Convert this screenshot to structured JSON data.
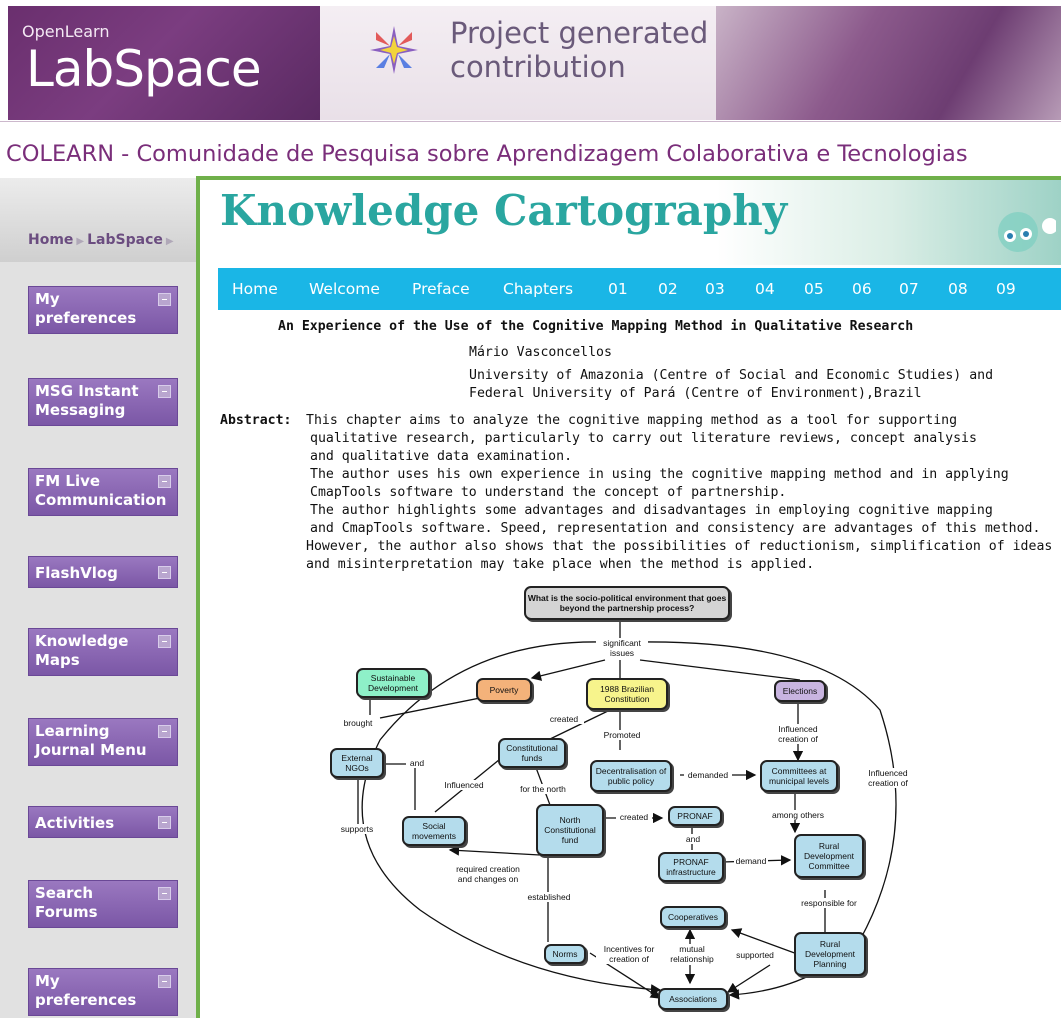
{
  "banner": {
    "logo_small": "OpenLearn",
    "logo_big": "LabSpace",
    "project_line1": "Project generated",
    "project_line2": "contribution"
  },
  "community_title": "COLEARN - Comunidade de Pesquisa sobre Aprendizagem Colaborativa e Tecnologias",
  "breadcrumb": {
    "home": "Home",
    "labspace": "LabSpace"
  },
  "sidebar": {
    "items": [
      {
        "label": "My preferences"
      },
      {
        "label": "MSG Instant Messaging"
      },
      {
        "label": "FM Live Communication"
      },
      {
        "label": "FlashVlog"
      },
      {
        "label": "Knowledge Maps"
      },
      {
        "label": "Learning Journal Menu"
      },
      {
        "label": "Activities"
      },
      {
        "label": "Search Forums"
      },
      {
        "label": "My preferences"
      }
    ]
  },
  "page_header": {
    "title": "Knowledge Cartography"
  },
  "nav": {
    "items": [
      "Home",
      "Welcome",
      "Preface",
      "Chapters",
      "01",
      "02",
      "03",
      "04",
      "05",
      "06",
      "07",
      "08",
      "09"
    ]
  },
  "article": {
    "title": "An Experience of the Use of the Cognitive Mapping Method in Qualitative Research",
    "author": "Mário Vasconcellos",
    "affiliation_line1": "University of Amazonia (Centre of Social and Economic Studies) and",
    "affiliation_line2": "Federal University of Pará (Centre of Environment),Brazil",
    "abstract_label": "Abstract:",
    "abstract_lines": [
      "This chapter aims to analyze the cognitive mapping method as a tool for supporting",
      "qualitative research, particularly to carry out literature reviews, concept analysis",
      "and qualitative data examination.",
      "The author uses his own experience in using the cognitive mapping method and in applying",
      "CmapTools software to understand the concept  of partnership.",
      "The author highlights some advantages and disadvantages in employing cognitive mapping",
      "and CmapTools software. Speed, representation and consistency are advantages of this method.",
      "However, the author also shows that the possibilities of reductionism, simplification of ideas",
      "and misinterpretation may take place when the method is applied."
    ]
  },
  "concept_map": {
    "colors": {
      "question": "#d4d4d4",
      "green": "#8ef0c8",
      "orange": "#f4b27a",
      "yellow": "#f7f48c",
      "purple": "#c8b4e0",
      "blue": "#b4dcec"
    },
    "nodes": {
      "question": "What is the socio-political environment that goes beyond the partnership process?",
      "sustainable": "Sustainable Development",
      "poverty": "Poverty",
      "constitution": "1988 Brazilian Constitution",
      "elections": "Elections",
      "external_ngos": "External NGOs",
      "const_funds": "Constitutional funds",
      "decentral": "Decentralisation of public policy",
      "committees": "Committees at municipal levels",
      "social": "Social movements",
      "north_fund": "North Constitutional fund",
      "pronaf": "PRONAF",
      "pronaf_infra": "PRONAF infrastructure",
      "rural_committee": "Rural Development Committee",
      "cooperatives": "Cooperatives",
      "norms": "Norms",
      "rural_planning": "Rural Development Planning",
      "associations": "Associations"
    },
    "links": {
      "significant": "significant issues",
      "brought": "brought",
      "created1": "created",
      "promoted": "Promoted",
      "influenced_creation": "Influenced creation of",
      "influenced_creation2": "Influenced creation of",
      "and1": "and",
      "influenced": "Influenced",
      "for_north": "for the north",
      "demanded": "demanded",
      "supports": "supports",
      "among_others": "among others",
      "created2": "created",
      "and2": "and",
      "required": "required creation and changes on",
      "demand": "demand",
      "established": "established",
      "responsible": "responsible for",
      "incentives": "Incentives for creation of",
      "mutual": "mutual relationship",
      "supported": "supported"
    }
  }
}
